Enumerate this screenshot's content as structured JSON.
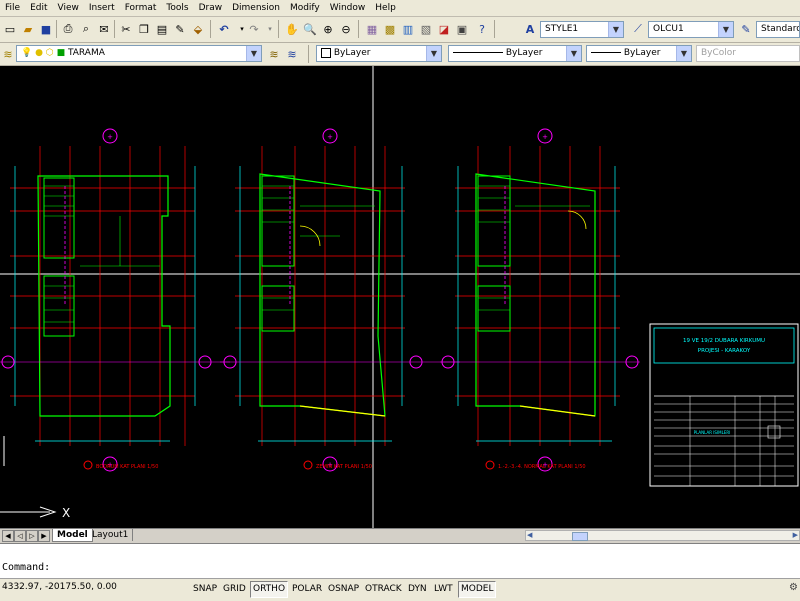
{
  "menu": [
    "File",
    "Edit",
    "View",
    "Insert",
    "Format",
    "Tools",
    "Draw",
    "Dimension",
    "Modify",
    "Window",
    "Help"
  ],
  "styles": {
    "text_style": "STYLE1",
    "dim_style": "OLCU1",
    "table_style": "Standard"
  },
  "properties": {
    "layer": "TARAMA",
    "color": "ByLayer",
    "linetype": "ByLayer",
    "lineweight": "ByLayer",
    "plotstyle": "ByColor"
  },
  "drawing": {
    "title_line1": "19 VE 19/2 DUBARA KIRKUMU",
    "title_line2": "PROJESI - KARAKOY",
    "plan_title": "PLANLAR ISIMLERI",
    "plan_labels": [
      "BODRUM KAT PLANI 1/50",
      "ZEMIN KAT PLANI 1/50",
      "1.-2.-3.-4. NORMAL KAT PLANI 1/50"
    ]
  },
  "tabs": [
    "Model",
    "Layout1"
  ],
  "command": {
    "prompt": "Command:"
  },
  "status": {
    "coords": "4332.97, -20175.50, 0.00",
    "toggles": [
      "SNAP",
      "GRID",
      "ORTHO",
      "POLAR",
      "OSNAP",
      "OTRACK",
      "DYN",
      "LWT",
      "MODEL"
    ],
    "active": [
      "ORTHO",
      "MODEL"
    ]
  },
  "colors": {
    "canvas": "#000000",
    "walls": "#00ff00",
    "grid_lines": "#ff0000",
    "axis_bubbles": "#ff00ff",
    "frame": "#00ffff",
    "doors": "#ffff00"
  }
}
